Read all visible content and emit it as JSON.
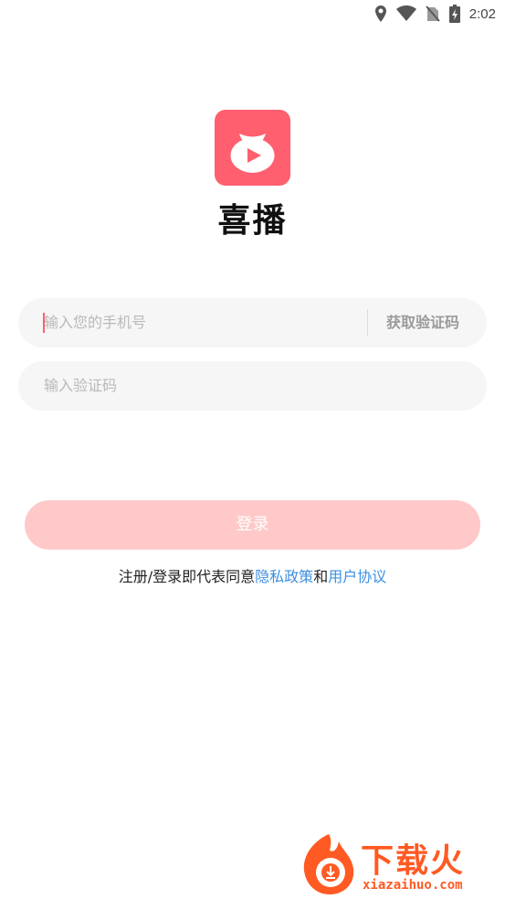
{
  "status_bar": {
    "time": "2:02",
    "icons": [
      "location-icon",
      "wifi-icon",
      "no-sim-icon",
      "battery-charging-icon"
    ]
  },
  "app": {
    "name": "喜播",
    "logo_icon": "piggy-bag-play-icon",
    "brand_color": "#ff5f6e"
  },
  "form": {
    "phone_placeholder": "输入您的手机号",
    "get_code_label": "获取验证码",
    "code_placeholder": "输入验证码",
    "login_label": "登录",
    "login_color": "#ffc9c9"
  },
  "agreement": {
    "prefix": "注册/登录即代表同意",
    "privacy_link": "隐私政策",
    "conjunction": "和",
    "terms_link": "用户协议",
    "link_color": "#3d8fe0"
  },
  "watermark": {
    "brand": "下载火",
    "site": "xiazaihuo.com",
    "color": "#ff5a23"
  }
}
